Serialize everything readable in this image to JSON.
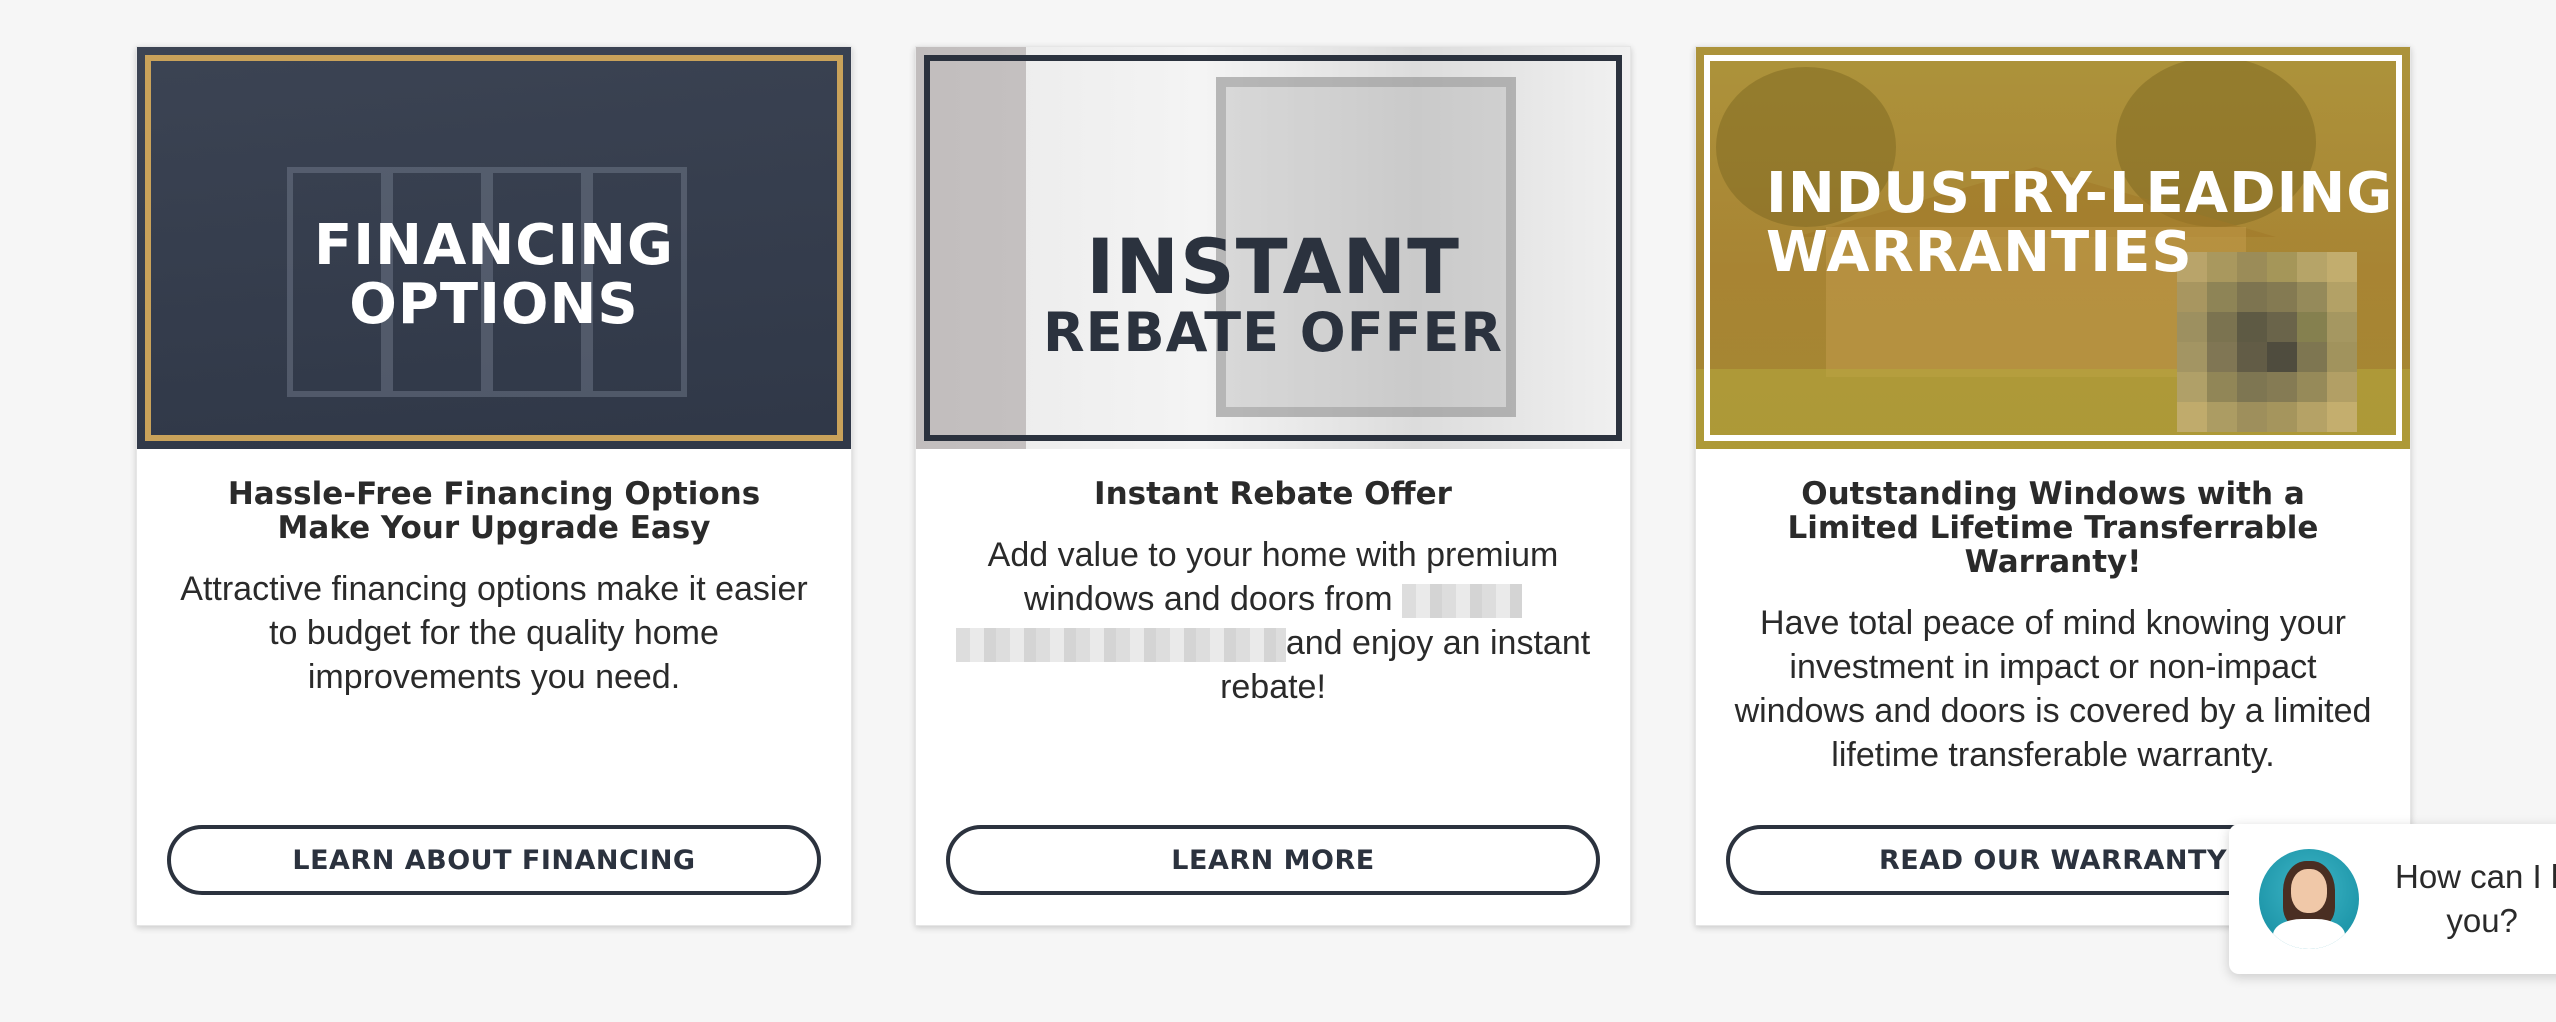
{
  "cards": [
    {
      "hero_line1": "FINANCING",
      "hero_line2": "OPTIONS",
      "heading": "Hassle-Free Financing Options Make Your Upgrade Easy",
      "text": "Attractive financing options make it easier to budget for the quality home improvements you need.",
      "button": "LEARN ABOUT FINANCING"
    },
    {
      "hero_line1": "INSTANT",
      "hero_line2": "REBATE OFFER",
      "heading": "Instant Rebate Offer",
      "text_part1": "Add value to your home with premium windows and doors from",
      "text_part2": "and enjoy an instant rebate!",
      "button": "LEARN MORE"
    },
    {
      "hero_line1": "INDUSTRY-LEADING",
      "hero_line2": "WARRANTIES",
      "heading": "Outstanding Windows with a Limited Lifetime Transferrable Warranty!",
      "text": "Have total peace of mind knowing your investment in impact or non-impact windows and doors is covered by a limited lifetime transferable warranty.",
      "button": "READ OUR WARRANTY"
    }
  ],
  "chat": {
    "line1": "How can I h",
    "line2": "you?"
  },
  "colors": {
    "navy": "#2b323e",
    "gold": "#c9a25a",
    "background": "#f6f6f6"
  }
}
